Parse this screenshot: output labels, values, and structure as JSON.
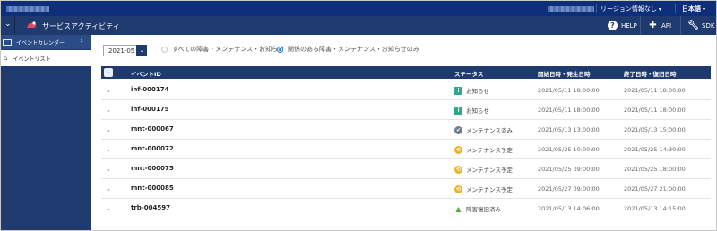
{
  "topbar": {
    "region_info_label": "リージョン情報なし",
    "language_label": "日本語"
  },
  "servicebar": {
    "title": "サービスアクティビティ",
    "help_label": "HELP",
    "api_label": "API",
    "sdk_label": "SDK"
  },
  "sidebar": {
    "items": [
      {
        "label": "イベントカレンダー"
      },
      {
        "label": "イベントリスト"
      }
    ]
  },
  "filters": {
    "month_value": "2021-05",
    "radio_all_label": "すべての障害・メンテナンス・お知らせ",
    "radio_related_label": "関係のある障害・メンテナンス・お知らせのみ",
    "selected": "related"
  },
  "table": {
    "columns": [
      "イベントID",
      "ステータス",
      "開始日時・発生日時",
      "終了日時・復旧日時"
    ],
    "rows": [
      {
        "id": "inf-000174",
        "status": "お知らせ",
        "status_icon": "info-icon",
        "status_color": "#2eaa8a",
        "start": "2021/05/11 18:00:00",
        "end": "2021/05/11 18:00:00"
      },
      {
        "id": "inf-000175",
        "status": "お知らせ",
        "status_icon": "info-icon",
        "status_color": "#2eaa8a",
        "start": "2021/05/11 18:00:00",
        "end": "2021/05/11 18:00:00"
      },
      {
        "id": "mnt-000067",
        "status": "メンテナンス済み",
        "status_icon": "maintenance-done-icon",
        "status_color": "#6f7c8c",
        "start": "2021/05/13 13:00:00",
        "end": "2021/05/13 15:00:00"
      },
      {
        "id": "mnt-000072",
        "status": "メンテナンス予定",
        "status_icon": "maintenance-scheduled-icon",
        "status_color": "#f0b323",
        "start": "2021/05/25 10:00:00",
        "end": "2021/05/25 14:30:00"
      },
      {
        "id": "mnt-000075",
        "status": "メンテナンス予定",
        "status_icon": "maintenance-scheduled-icon",
        "status_color": "#f0b323",
        "start": "2021/05/25 09:00:00",
        "end": "2021/05/25 18:00:00"
      },
      {
        "id": "mnt-000085",
        "status": "メンテナンス予定",
        "status_icon": "maintenance-scheduled-icon",
        "status_color": "#f0b323",
        "start": "2021/05/27 09:00:00",
        "end": "2021/05/27 21:00:00"
      },
      {
        "id": "trb-004597",
        "status": "障害復旧済み",
        "status_icon": "trouble-resolved-icon",
        "status_color": "#5aa84a",
        "start": "2021/05/13 14:06:00",
        "end": "2021/05/13 14:15:00"
      }
    ]
  },
  "colors": {
    "topbar": "#0d2f7a",
    "servicebar": "#1f3a6e",
    "accent": "#2a7de1"
  }
}
